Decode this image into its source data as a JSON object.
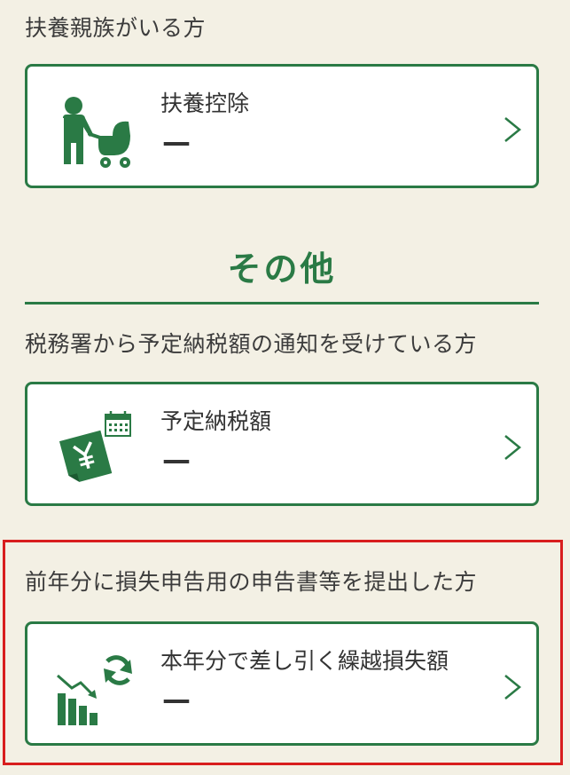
{
  "sections": {
    "dependents": {
      "label": "扶養親族がいる方",
      "card": {
        "title": "扶養控除",
        "value": "—",
        "icon": "person-with-stroller-icon"
      }
    },
    "other": {
      "heading": "その他"
    },
    "tax_office_notice": {
      "label": "税務署から予定納税額の通知を受けている方",
      "card": {
        "title": "予定納税額",
        "value": "—",
        "icon": "yen-document-calendar-icon"
      }
    },
    "loss_carryforward": {
      "label": "前年分に損失申告用の申告書等を提出した方",
      "card": {
        "title": "本年分で差し引く繰越損失額",
        "value": "—",
        "icon": "declining-chart-refresh-icon"
      }
    }
  },
  "colors": {
    "accent_green": "#2a7a45",
    "highlight_red": "#d81e1e",
    "background": "#f3f0e4"
  }
}
